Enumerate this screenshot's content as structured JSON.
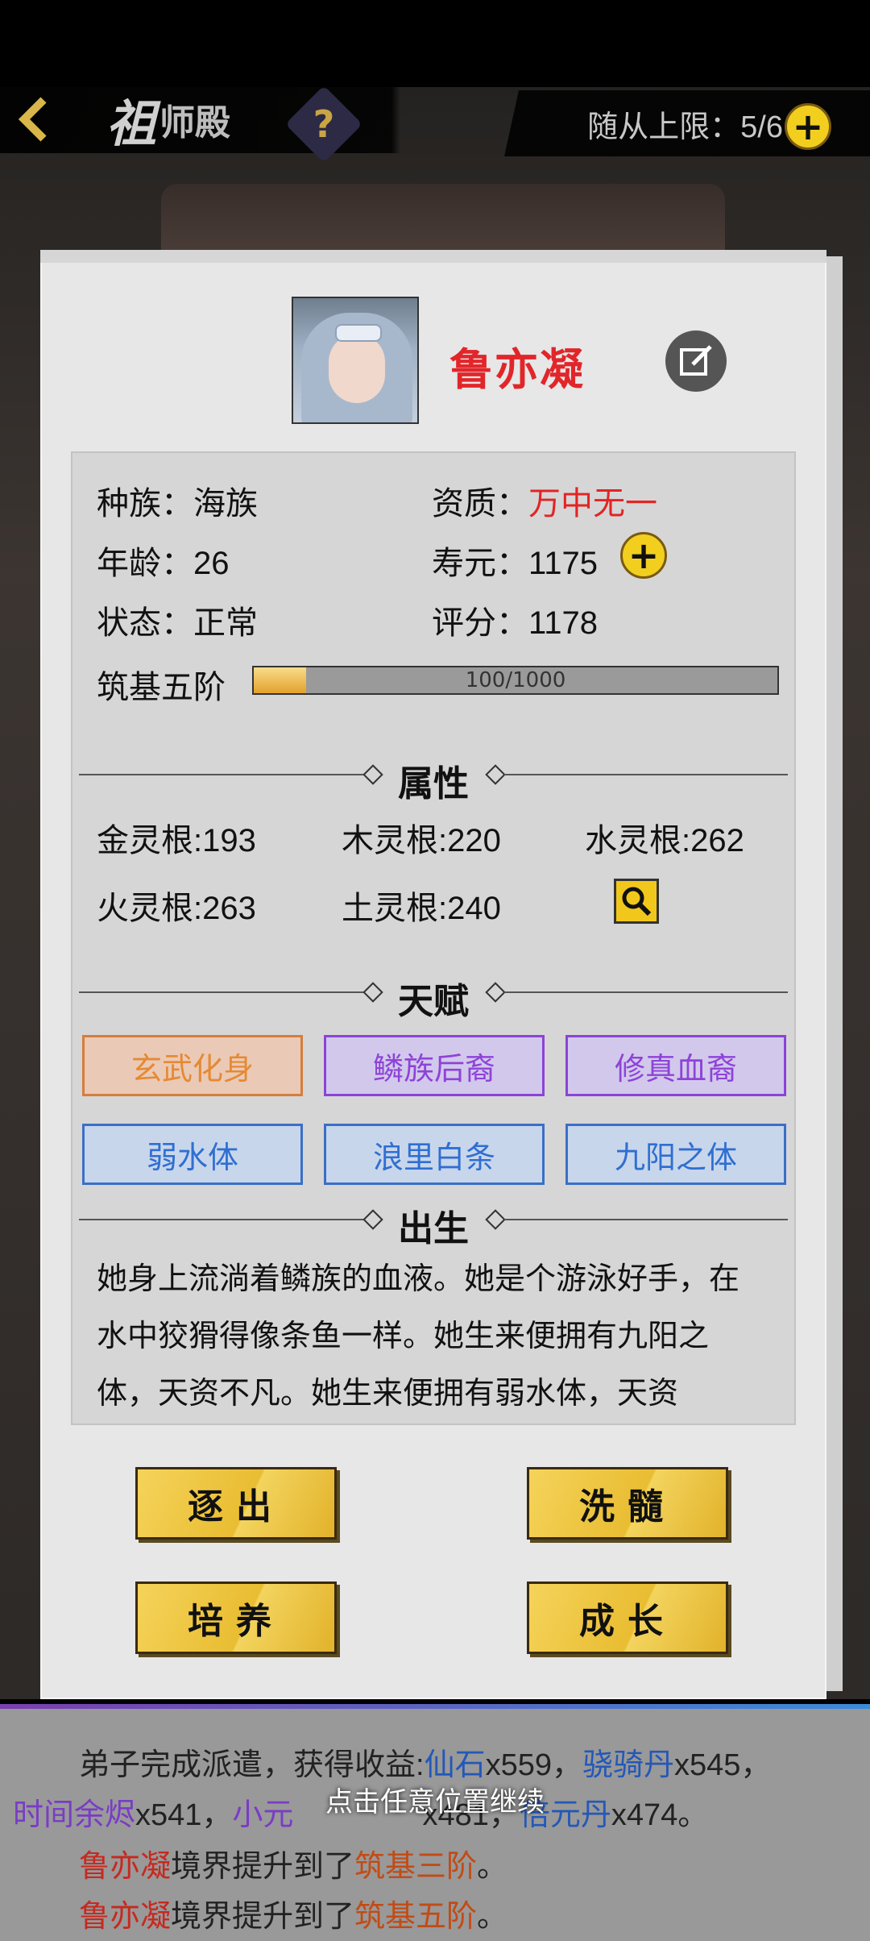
{
  "header": {
    "title_big": "祖",
    "title_small": "师殿",
    "follower_limit_label": "随从上限：5/6"
  },
  "character": {
    "name": "鲁亦凝",
    "race_label": "种族：",
    "race": "海族",
    "aptitude_label": "资质：",
    "aptitude": "万中无一",
    "age_label": "年龄：",
    "age": "26",
    "lifespan_label": "寿元：",
    "lifespan": "1175",
    "status_label": "状态：",
    "status": "正常",
    "score_label": "评分：",
    "score": "1178",
    "realm": "筑基五阶",
    "exp_text": "100/1000",
    "exp_fraction": 0.1
  },
  "attributes": {
    "title": "属性",
    "items": [
      "金灵根:193",
      "木灵根:220",
      "水灵根:262",
      "火灵根:263",
      "土灵根:240"
    ]
  },
  "talents": {
    "title": "天赋",
    "items": [
      {
        "label": "玄武化身",
        "tier": "orange"
      },
      {
        "label": "鳞族后裔",
        "tier": "purple"
      },
      {
        "label": "修真血裔",
        "tier": "purple"
      },
      {
        "label": "弱水体",
        "tier": "blue"
      },
      {
        "label": "浪里白条",
        "tier": "blue"
      },
      {
        "label": "九阳之体",
        "tier": "blue"
      }
    ]
  },
  "birth": {
    "title": "出生",
    "text": "她身上流淌着鳞族的血液。她是个游泳好手，在水中狡猾得像条鱼一样。她生来便拥有九阳之体，天资不凡。她生来便拥有弱水体，天资"
  },
  "actions": {
    "expel": "逐出",
    "cleanse": "洗髓",
    "cultivate": "培养",
    "grow": "成长"
  },
  "log": {
    "line1_prefix": "弟子完成派遣，获得收益:",
    "line1_item1": "仙石",
    "line1_qty1": "x559，",
    "line1_item2": "骁骑丹",
    "line1_qty2": "x545，",
    "line2_item1": "时间余烬",
    "line2_qty1": "x541，",
    "line2_item2": "小元",
    "line2_mid": "x481，",
    "line2_item3": "倍元丹",
    "line2_qty3": "x474。",
    "line3_name": "鲁亦凝",
    "line3_text": "境界提升到了",
    "line3_realm": "筑基三阶",
    "line3_end": "。",
    "line4_name": "鲁亦凝",
    "line4_text": "境界提升到了",
    "line4_realm": "筑基五阶",
    "line4_end": "。",
    "continue_hint": "点击任意位置继续"
  },
  "colors": {
    "name_red": "#e1262a",
    "gold": "#f2cf1e",
    "talent_orange": "#e58a32",
    "talent_purple": "#8e43d8",
    "talent_blue": "#2f6fd1"
  }
}
